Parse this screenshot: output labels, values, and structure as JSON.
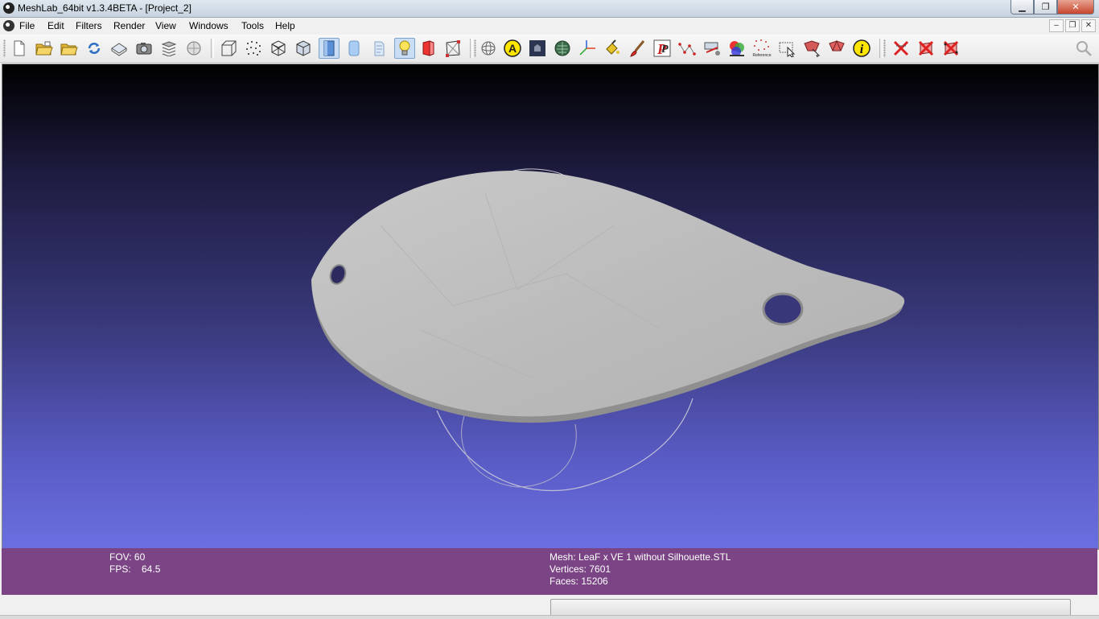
{
  "window": {
    "title": "MeshLab_64bit v1.3.4BETA - [Project_2]",
    "controls": {
      "minimize": "▁",
      "restore": "❐",
      "close": "✕"
    }
  },
  "menubar": {
    "items": [
      "File",
      "Edit",
      "Filters",
      "Render",
      "View",
      "Windows",
      "Tools",
      "Help"
    ],
    "mdi_controls": {
      "minimize": "–",
      "restore": "❐",
      "close": "✕"
    }
  },
  "toolbar": {
    "groups": [
      [
        "new-project-icon",
        "open-project-icon",
        "open-mesh-icon",
        "reload-icon",
        "save-icon",
        "snapshot-icon",
        "layers-icon",
        "sphere-icon"
      ],
      [
        "bounding-box-icon",
        "points-icon",
        "wireframe-icon",
        "hidden-lines-icon",
        "flat-icon",
        "smooth-icon",
        "texture-icon",
        "light-icon",
        "backface-icon",
        "box-select-icon"
      ],
      [
        "trackball-icon",
        "annotation-icon",
        "dark-shader-icon",
        "tree-icon",
        "axes-icon",
        "paint-bucket-icon",
        "brush-icon",
        "pickpoints-icon",
        "align-icon",
        "measure-icon",
        "color-icon",
        "reference-icon",
        "select-faces-icon",
        "select-vertices-icon",
        "connected-select-icon",
        "info-icon"
      ],
      [
        "delete-faces-icon",
        "delete-selection-icon",
        "delete-vertices-icon"
      ]
    ],
    "reference_text": "Reference",
    "annotation_letter": "A",
    "info_letter": "i",
    "pickpoints_letter": "P"
  },
  "colors": {
    "accent": "#7b4585",
    "viewport_top": "#000000",
    "viewport_bottom": "#6a6fe0",
    "mesh": "#bdbdbd"
  },
  "info": {
    "fov": "FOV: 60",
    "fps": "FPS:    64.5",
    "mesh": "Mesh: LeaF x VE 1 without Silhouette.STL",
    "vertices": "Vertices: 7601",
    "faces": "Faces: 15206"
  }
}
